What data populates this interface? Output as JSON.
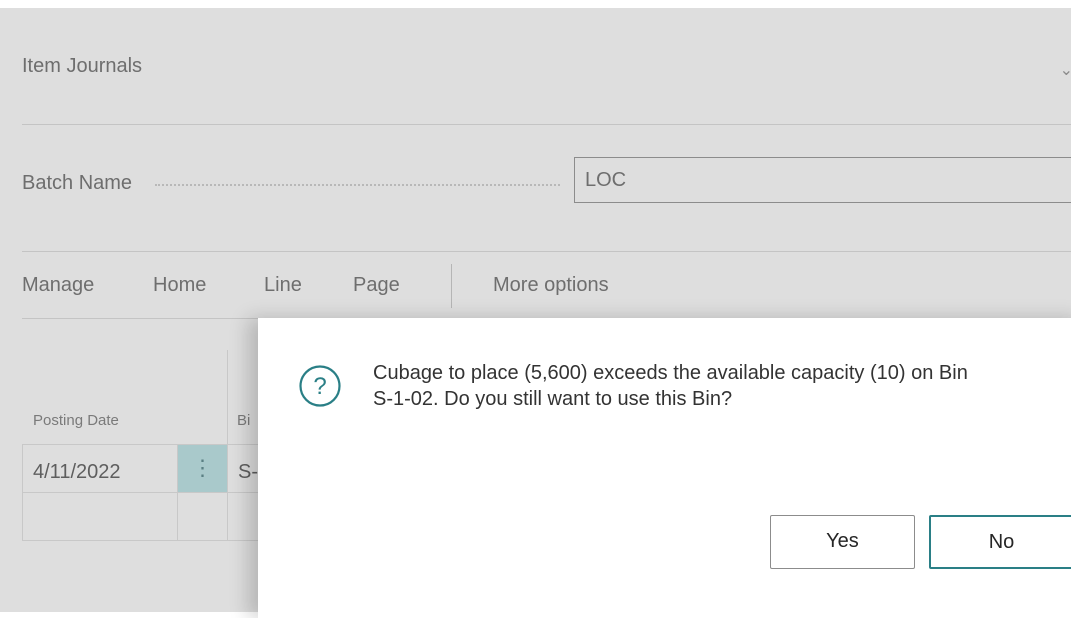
{
  "page": {
    "title": "Item Journals",
    "batch_label": "Batch Name",
    "batch_value": "LOC"
  },
  "actions": {
    "manage": "Manage",
    "home": "Home",
    "line": "Line",
    "page": "Page",
    "more": "More options"
  },
  "grid": {
    "headers": [
      "Posting Date",
      "Bi"
    ],
    "row": {
      "posting_date": "4/11/2022",
      "menu_glyph": "⋮",
      "bin_partial": "S-"
    }
  },
  "dialog": {
    "icon": "question-icon",
    "message": "Cubage to place (5,600) exceeds the available capacity (10) on Bin\nS-1-02. Do you still want to use this Bin?",
    "yes_label": "Yes",
    "no_label": "No"
  },
  "colors": {
    "accent": "#2a7f86",
    "overlay": "#dedede",
    "row_menu_bg": "#a9c9cb"
  }
}
